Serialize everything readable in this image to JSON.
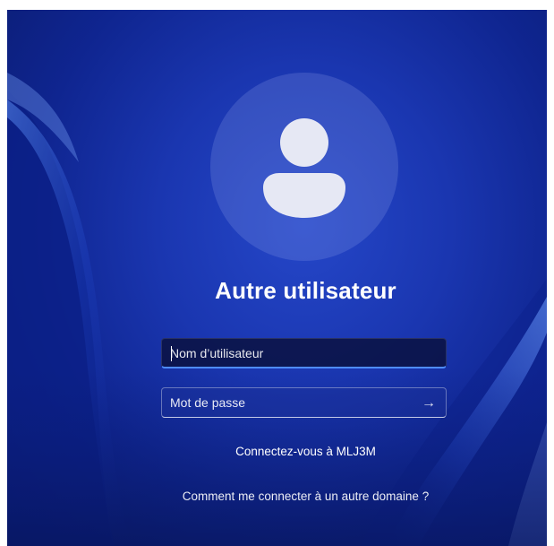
{
  "user": {
    "title": "Autre utilisateur"
  },
  "login": {
    "username_placeholder": "Nom d’utilisateur",
    "username_value": "",
    "password_placeholder": "Mot de passe",
    "password_value": "",
    "submit_icon": "arrow-right-icon"
  },
  "links": {
    "signin_machine": "Connectez-vous à MLJ3M",
    "other_domain": "Comment me connecter à un autre domaine ?"
  },
  "icons": {
    "avatar": "person-icon"
  },
  "colors": {
    "background": "#1a36b0",
    "focus_accent": "#4f8cff",
    "avatar": "#e6e8f4"
  }
}
